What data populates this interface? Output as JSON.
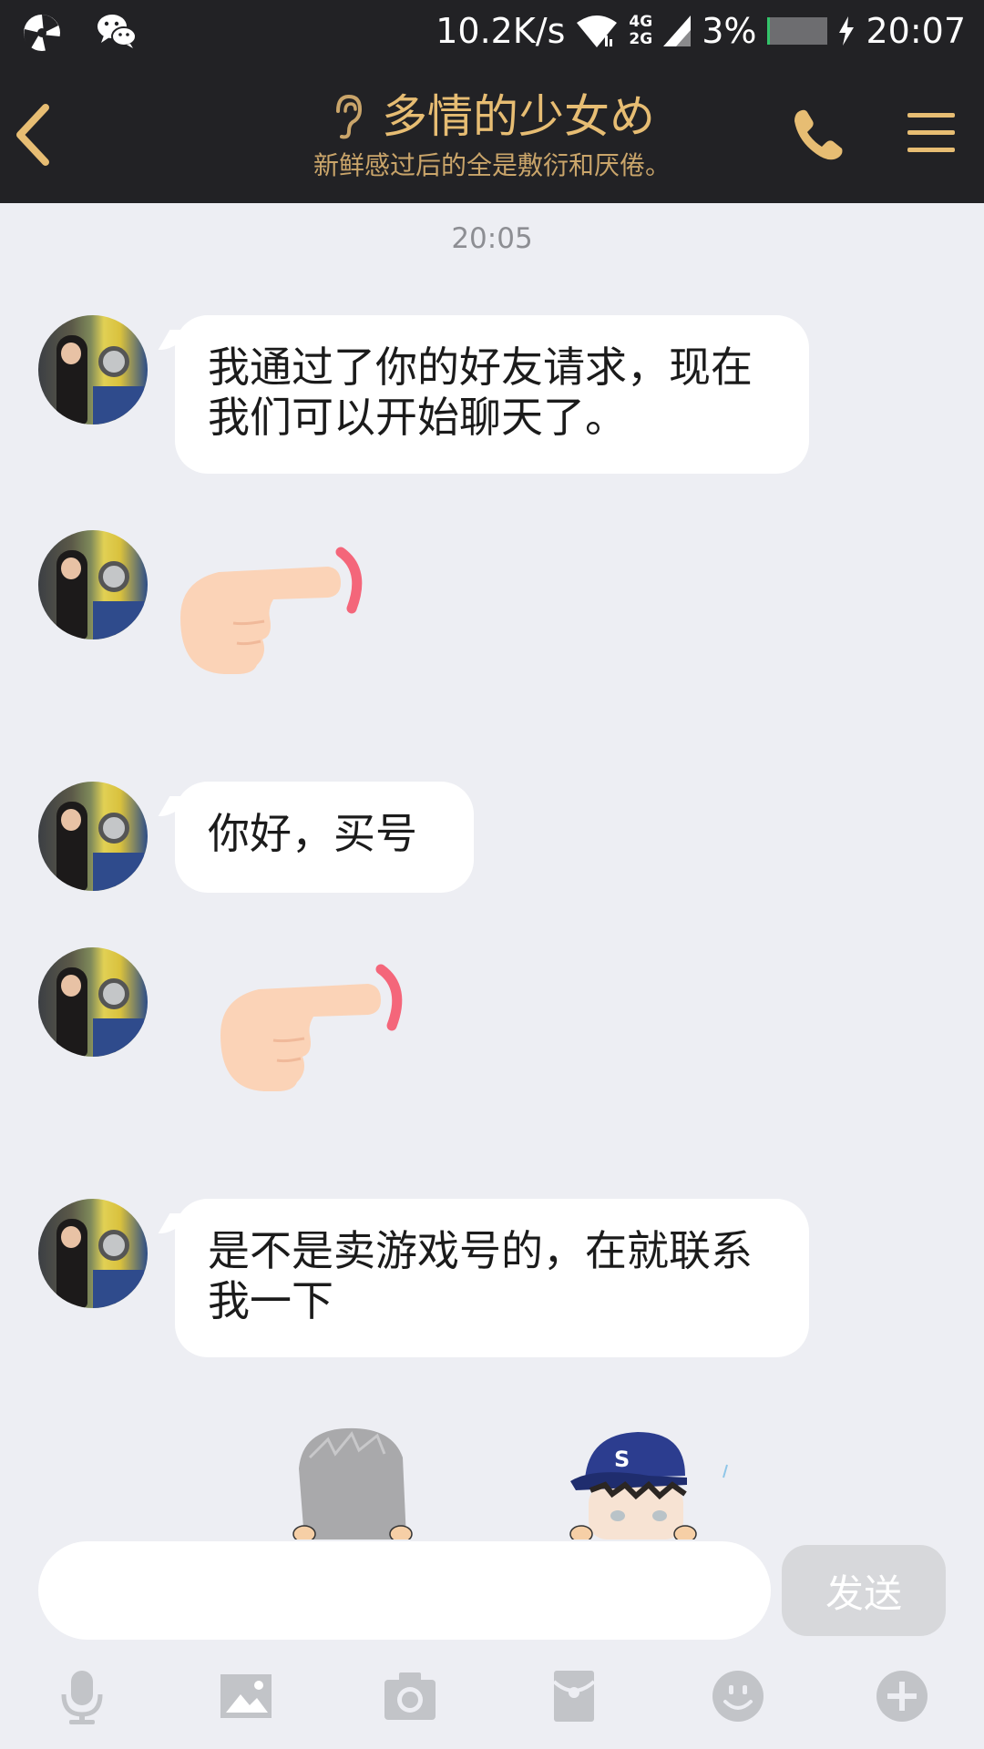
{
  "status_bar": {
    "net_speed": "10.2K/s",
    "net_type_top": "4G",
    "net_type_bottom": "2G",
    "battery": "3%",
    "time": "20:07"
  },
  "header": {
    "title": "多情的少女め",
    "subtitle": "新鲜感过后的全是敷衍和厌倦。"
  },
  "chat": {
    "timestamp": "20:05",
    "messages": [
      {
        "type": "text",
        "text": "我通过了你的好友请求，现在我们可以开始聊天了。"
      },
      {
        "type": "sticker",
        "sticker": "pointing-hand"
      },
      {
        "type": "text",
        "text": "你好，买号"
      },
      {
        "type": "sticker",
        "sticker": "pointing-hand"
      },
      {
        "type": "text",
        "text": "是不是卖游戏号的，在就联系我一下"
      }
    ]
  },
  "composer": {
    "input_value": "",
    "send_label": "发送"
  },
  "toolbar": {
    "icons": [
      "microphone-icon",
      "image-icon",
      "camera-icon",
      "red-packet-icon",
      "emoji-icon",
      "plus-icon"
    ]
  },
  "colors": {
    "header_bg": "#222225",
    "header_accent": "#e7bd73",
    "chat_bg": "#edeef3",
    "bubble_bg": "#ffffff",
    "send_disabled": "#d7d8db"
  }
}
